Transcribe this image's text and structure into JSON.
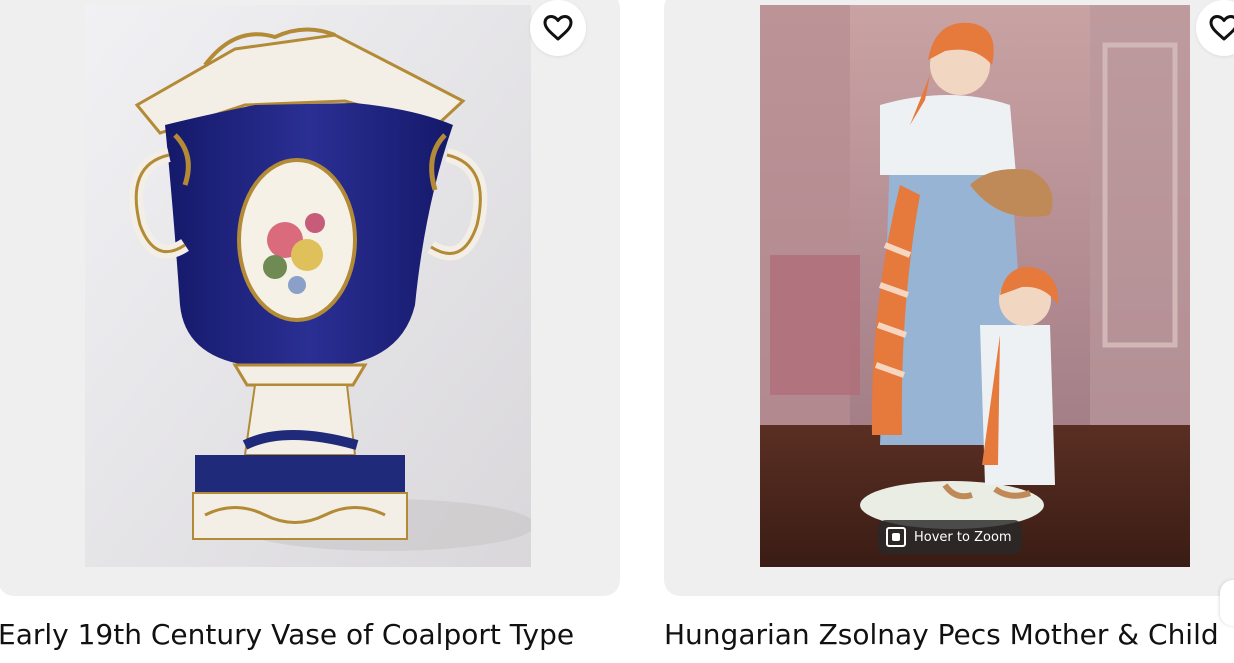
{
  "listings": [
    {
      "title": "Early 19th Century Vase of Coalport Type",
      "favorite_icon": "heart-outline-icon",
      "image_subject": "vase"
    },
    {
      "title": "Hungarian Zsolnay Pecs Mother & Child",
      "favorite_icon": "heart-outline-icon",
      "image_subject": "figurine",
      "zoom_hint": "Hover to Zoom"
    }
  ],
  "colors": {
    "card_bg": "#efefef",
    "cobalt": "#1f2a7a",
    "gold": "#b38a35",
    "orange": "#e6793c",
    "heart_red": "#e0383e"
  }
}
